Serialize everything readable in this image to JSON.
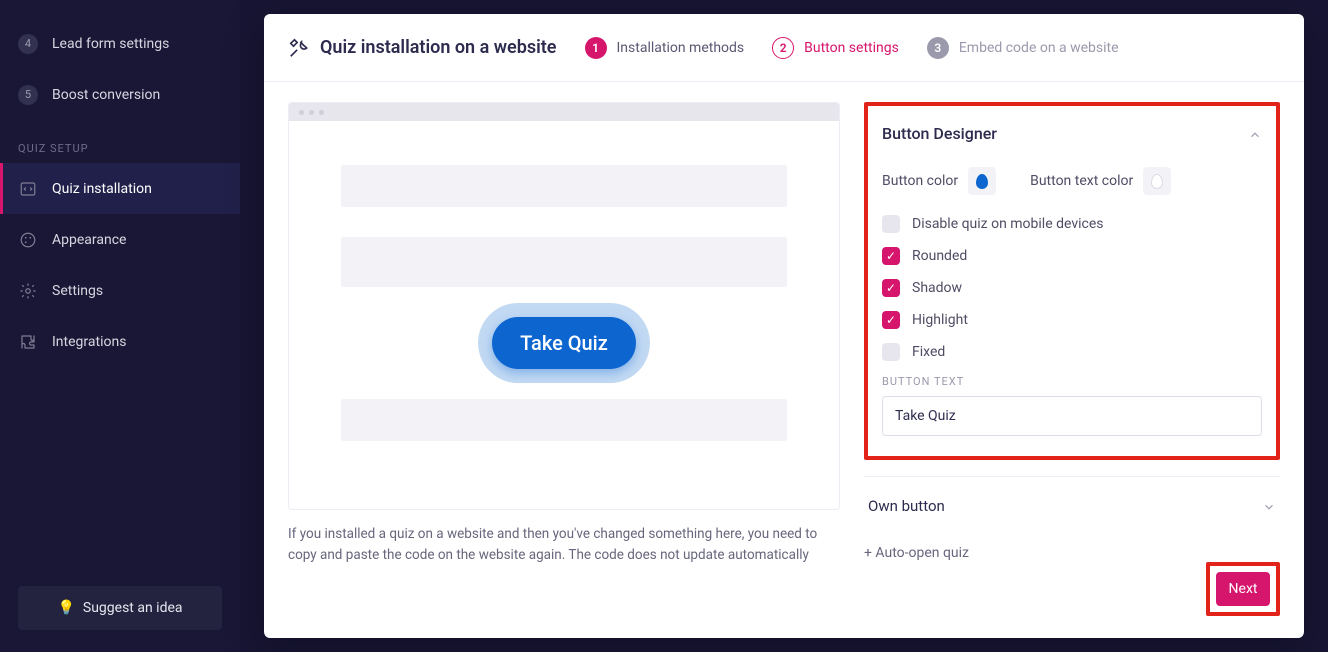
{
  "sidebar": {
    "step4": {
      "num": "4",
      "label": "Lead form settings"
    },
    "step5": {
      "num": "5",
      "label": "Boost conversion"
    },
    "group_label": "Quiz setup",
    "items": {
      "install": "Quiz installation",
      "appearance": "Appearance",
      "settings": "Settings",
      "integrations": "Integrations"
    },
    "suggest_label": "Suggest an idea"
  },
  "header": {
    "title": "Quiz installation on a website",
    "steps": {
      "s1": {
        "num": "1",
        "label": "Installation methods"
      },
      "s2": {
        "num": "2",
        "label": "Button settings"
      },
      "s3": {
        "num": "3",
        "label": "Embed code on a website"
      }
    }
  },
  "preview": {
    "button_label": "Take Quiz"
  },
  "note_text": "If you installed a quiz on a website and then you've changed something here, you need to copy and paste the code on the website again. The code does not update automatically",
  "designer": {
    "title": "Button Designer",
    "btn_color_label": "Button color",
    "txt_color_label": "Button text color",
    "checks": {
      "disable_mobile": "Disable quiz on mobile devices",
      "rounded": "Rounded",
      "shadow": "Shadow",
      "highlight": "Highlight",
      "fixed": "Fixed"
    },
    "button_text_label": "Button text",
    "button_text_value": "Take Quiz",
    "button_color_hex": "#0d66d0",
    "text_color_hex": "#ffffff"
  },
  "own_button_title": "Own button",
  "auto_open_label": "+ Auto-open quiz",
  "next_label": "Next"
}
